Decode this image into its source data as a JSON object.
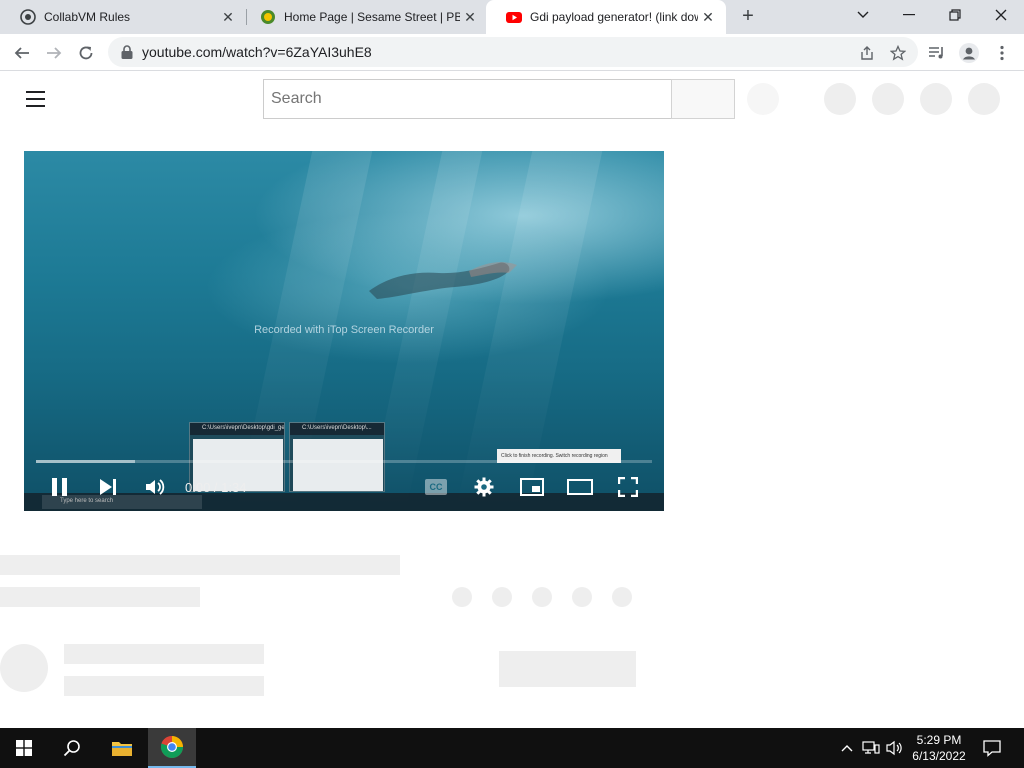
{
  "browser": {
    "tabs": [
      {
        "title": "CollabVM Rules",
        "icon": "collabvm-icon",
        "active": false
      },
      {
        "title": "Home Page | Sesame Street | PBS",
        "icon": "sesame-street-icon",
        "active": false
      },
      {
        "title": "Gdi payload generator! (link dow",
        "icon": "youtube-icon",
        "active": true
      }
    ],
    "new_tab": "+",
    "url": "youtube.com/watch?v=6ZaYAI3uhE8"
  },
  "youtube": {
    "search_placeholder": "Search"
  },
  "player": {
    "watermark": "Recorded with iTop Screen Recorder",
    "time_current": "0:00",
    "time_separator": " / ",
    "time_total": "1:34",
    "cc_label": "CC",
    "embedded_thumb_1": "C:\\Users\\ivepn\\Desktop\\gdi_ge...",
    "embedded_thumb_2": "C:\\Users\\ivepn\\Desktop\\...",
    "embedded_tooltip": "Click to finish recording. Switch recording region",
    "embedded_search": "Type here to search",
    "progress": {
      "played": 0.0,
      "loaded": 0.16
    }
  },
  "taskbar": {
    "time": "5:29 PM",
    "date": "6/13/2022"
  }
}
